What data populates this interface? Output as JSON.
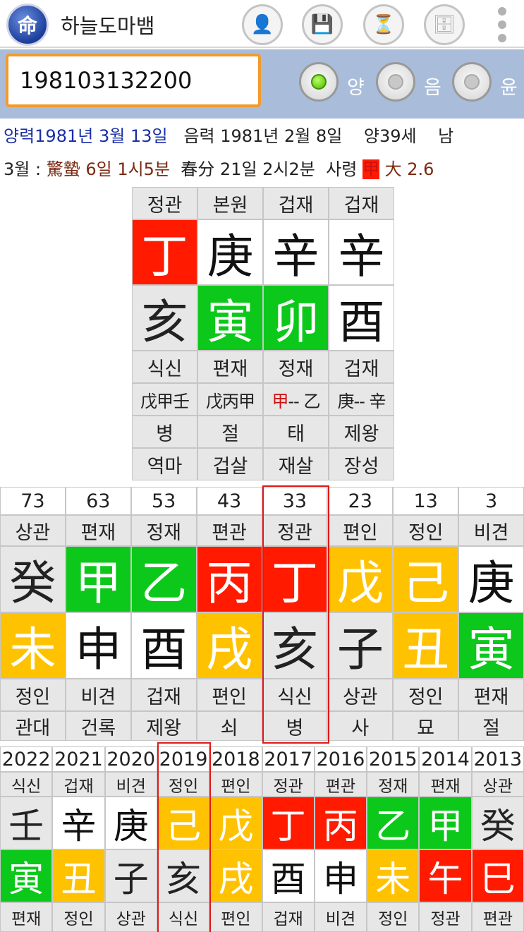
{
  "app": {
    "title": "하늘도마뱀",
    "logo_char": "命"
  },
  "toolbar": {
    "add_person_glyph": "👤",
    "save_glyph": "💾",
    "timer_glyph": "⏳",
    "database_glyph": "🗄"
  },
  "input": {
    "value": "198103132200"
  },
  "calendar_mode": {
    "options": [
      {
        "label": "양",
        "selected": true
      },
      {
        "label": "음",
        "selected": false
      },
      {
        "label": "윤",
        "selected": false
      }
    ]
  },
  "info": {
    "solar": "양력1981년 3월 13일",
    "lunar": "음력 1981년 2월 8일",
    "age": "양39세",
    "gender": "남",
    "month_label": "3월 :",
    "term1": "驚蟄 6일 1시5분",
    "term2": "春分 21일 2시2분",
    "saryeong_label": "사령",
    "saryeong_char": "甲",
    "daeun_label": "大 2.6"
  },
  "colors": {
    "red": "#ff1a00",
    "green": "#0cc81a",
    "yellow": "#ffc200",
    "gray": "#7c7c7c",
    "white": "#ffffff",
    "input_border": "#f29a2e",
    "band": "#a9bdda",
    "highlight": "#e01818"
  },
  "pillars": {
    "top_labels": [
      "정관",
      "본원",
      "겁재",
      "겁재"
    ],
    "stems": [
      {
        "char": "丁",
        "color": "red"
      },
      {
        "char": "庚",
        "color": "white"
      },
      {
        "char": "辛",
        "color": "white"
      },
      {
        "char": "辛",
        "color": "white"
      }
    ],
    "branches": [
      {
        "char": "亥",
        "color": "gray"
      },
      {
        "char": "寅",
        "color": "green"
      },
      {
        "char": "卯",
        "color": "green"
      },
      {
        "char": "酉",
        "color": "white"
      }
    ],
    "branch_labels": [
      "식신",
      "편재",
      "정재",
      "겁재"
    ],
    "hidden_stems": [
      {
        "highlight": "",
        "rest": "戊甲壬"
      },
      {
        "highlight": "",
        "rest": "戊丙甲"
      },
      {
        "highlight": "甲",
        "rest": "-- 乙"
      },
      {
        "highlight": "",
        "rest": "庚-- 辛"
      }
    ],
    "twelve_stages": [
      "병",
      "절",
      "태",
      "제왕"
    ],
    "spirits": [
      "역마",
      "겁살",
      "재살",
      "장성"
    ]
  },
  "daeun": {
    "ages": [
      "73",
      "63",
      "53",
      "43",
      "33",
      "23",
      "13",
      "3"
    ],
    "stem_labels": [
      "상관",
      "편재",
      "정재",
      "편관",
      "정관",
      "편인",
      "정인",
      "비견"
    ],
    "stems": [
      {
        "char": "癸",
        "color": "gray"
      },
      {
        "char": "甲",
        "color": "green"
      },
      {
        "char": "乙",
        "color": "green"
      },
      {
        "char": "丙",
        "color": "red"
      },
      {
        "char": "丁",
        "color": "red"
      },
      {
        "char": "戊",
        "color": "yellow"
      },
      {
        "char": "己",
        "color": "yellow"
      },
      {
        "char": "庚",
        "color": "white"
      }
    ],
    "branches": [
      {
        "char": "未",
        "color": "yellow"
      },
      {
        "char": "申",
        "color": "white"
      },
      {
        "char": "酉",
        "color": "white"
      },
      {
        "char": "戌",
        "color": "yellow"
      },
      {
        "char": "亥",
        "color": "gray"
      },
      {
        "char": "子",
        "color": "gray"
      },
      {
        "char": "丑",
        "color": "yellow"
      },
      {
        "char": "寅",
        "color": "green"
      }
    ],
    "branch_labels": [
      "정인",
      "비견",
      "겁재",
      "편인",
      "식신",
      "상관",
      "정인",
      "편재"
    ],
    "twelve_stages": [
      "관대",
      "건록",
      "제왕",
      "쇠",
      "병",
      "사",
      "묘",
      "절"
    ],
    "current_index": 4
  },
  "seun": {
    "years": [
      "2022",
      "2021",
      "2020",
      "2019",
      "2018",
      "2017",
      "2016",
      "2015",
      "2014",
      "2013"
    ],
    "stem_labels": [
      "식신",
      "겁재",
      "비견",
      "정인",
      "편인",
      "정관",
      "편관",
      "정재",
      "편재",
      "상관"
    ],
    "stems": [
      {
        "char": "壬",
        "color": "gray"
      },
      {
        "char": "辛",
        "color": "white"
      },
      {
        "char": "庚",
        "color": "white"
      },
      {
        "char": "己",
        "color": "yellow"
      },
      {
        "char": "戊",
        "color": "yellow"
      },
      {
        "char": "丁",
        "color": "red"
      },
      {
        "char": "丙",
        "color": "red"
      },
      {
        "char": "乙",
        "color": "green"
      },
      {
        "char": "甲",
        "color": "green"
      },
      {
        "char": "癸",
        "color": "gray"
      }
    ],
    "branches": [
      {
        "char": "寅",
        "color": "green"
      },
      {
        "char": "丑",
        "color": "yellow"
      },
      {
        "char": "子",
        "color": "gray"
      },
      {
        "char": "亥",
        "color": "gray"
      },
      {
        "char": "戌",
        "color": "yellow"
      },
      {
        "char": "酉",
        "color": "white"
      },
      {
        "char": "申",
        "color": "white"
      },
      {
        "char": "未",
        "color": "yellow"
      },
      {
        "char": "午",
        "color": "red"
      },
      {
        "char": "巳",
        "color": "red"
      }
    ],
    "branch_labels": [
      "편재",
      "정인",
      "상관",
      "식신",
      "편인",
      "겁재",
      "비견",
      "정인",
      "정관",
      "편관"
    ],
    "current_index": 3
  }
}
